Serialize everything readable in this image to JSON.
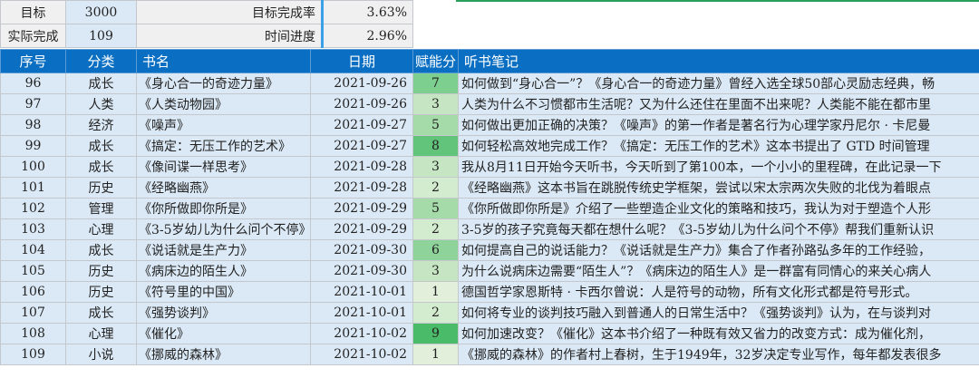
{
  "summary": {
    "target_label": "目标",
    "target_value": "3000",
    "actual_label": "实际完成",
    "actual_value": "109",
    "completion_rate_label": "目标完成率",
    "completion_rate_value": "3.63%",
    "time_progress_label": "时间进度",
    "time_progress_value": "2.96%"
  },
  "colors": {
    "header_bg": "#0a6fc2",
    "cell_bg": "#dbe9f6",
    "score_scale": {
      "1": "#e2f0db",
      "2": "#d3ebcf",
      "3": "#c6e6c3",
      "5": "#a4dba8",
      "6": "#8ed39a",
      "7": "#7ccf8e",
      "8": "#62c47b",
      "9": "#4abb68"
    }
  },
  "table": {
    "headers": [
      "序号",
      "分类",
      "书名",
      "日期",
      "赋能分",
      "听书笔记"
    ],
    "rows": [
      {
        "no": "96",
        "category": "成长",
        "title": "《身心合一的奇迹力量》",
        "date": "2021-09-26",
        "score": "7",
        "note": "如何做到“身心合一”？《身心合一的奇迹力量》曾经入选全球50部心灵励志经典，畅"
      },
      {
        "no": "97",
        "category": "人类",
        "title": "《人类动物园》",
        "date": "2021-09-26",
        "score": "3",
        "note": "人类为什么不习惯都市生活呢？又为什么还住在里面不出来呢？人类能不能在都市里"
      },
      {
        "no": "98",
        "category": "经济",
        "title": "《噪声》",
        "date": "2021-09-27",
        "score": "5",
        "note": "如何做出更加正确的决策？《噪声》的第一作者是著名行为心理学家丹尼尔 · 卡尼曼"
      },
      {
        "no": "99",
        "category": "成长",
        "title": "《搞定：无压工作的艺术》",
        "date": "2021-09-27",
        "score": "8",
        "note": "如何轻松高效地完成工作？《搞定：无压工作的艺术》这本书提出了 GTD 时间管理"
      },
      {
        "no": "100",
        "category": "成长",
        "title": "《像间谍一样思考》",
        "date": "2021-09-28",
        "score": "3",
        "note": "我从8月11日开始今天听书，今天听到了第100本，一个小小的里程碑，在此记录一下"
      },
      {
        "no": "101",
        "category": "历史",
        "title": "《经略幽燕》",
        "date": "2021-09-28",
        "score": "2",
        "note": "《经略幽燕》这本书旨在跳脱传统史学框架，尝试以宋太宗两次失败的北伐为着眼点"
      },
      {
        "no": "102",
        "category": "管理",
        "title": "《你所做即你所是》",
        "date": "2021-09-29",
        "score": "5",
        "note": "《你所做即你所是》介绍了一些塑造企业文化的策略和技巧，我认为对于塑造个人形"
      },
      {
        "no": "103",
        "category": "心理",
        "title": "《3-5岁幼儿为什么问个不停》",
        "date": "2021-09-29",
        "score": "2",
        "note": "3-5岁的孩子究竟每天都在想什么呢？《3-5岁幼儿为什么问个不停》帮我们重新认识"
      },
      {
        "no": "104",
        "category": "成长",
        "title": "《说话就是生产力》",
        "date": "2021-09-30",
        "score": "6",
        "note": "如何提高自己的说话能力？《说话就是生产力》集合了作者孙路弘多年的工作经验，"
      },
      {
        "no": "105",
        "category": "历史",
        "title": "《病床边的陌生人》",
        "date": "2021-09-30",
        "score": "3",
        "note": "为什么说病床边需要“陌生人”？《病床边的陌生人》是一群富有同情心的来关心病人"
      },
      {
        "no": "106",
        "category": "历史",
        "title": "《符号里的中国》",
        "date": "2021-10-01",
        "score": "1",
        "note": "德国哲学家恩斯特 · 卡西尔曾说：人是符号的动物，所有文化形式都是符号形式。"
      },
      {
        "no": "107",
        "category": "成长",
        "title": "《强势谈判》",
        "date": "2021-10-01",
        "score": "2",
        "note": "如何将专业的谈判技巧融入到普通人的日常生活中？《强势谈判》认为，在与谈判对"
      },
      {
        "no": "108",
        "category": "心理",
        "title": "《催化》",
        "date": "2021-10-02",
        "score": "9",
        "note": "如何加速改变？《催化》这本书介绍了一种既有效又省力的改变方式：成为催化剂，"
      },
      {
        "no": "109",
        "category": "小说",
        "title": "《挪威的森林》",
        "date": "2021-10-02",
        "score": "1",
        "note": "《挪威的森林》的作者村上春树，生于1949年，32岁决定专业写作，每年都发表很多"
      }
    ]
  }
}
